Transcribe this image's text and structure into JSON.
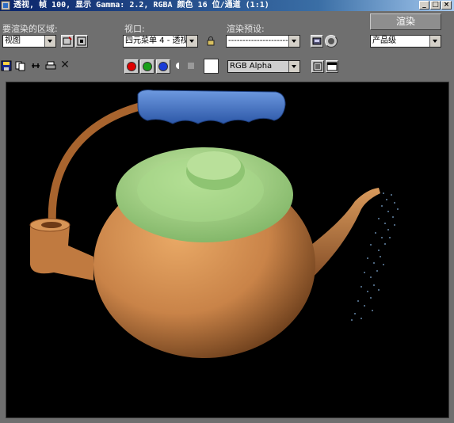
{
  "window": {
    "title": "透视, 帧 100, 显示 Gamma: 2.2, RGBA 颜色 16 位/通道 (1:1)",
    "min_label": "_",
    "max_label": "□",
    "close_label": "×"
  },
  "controls": {
    "area_label": "要渲染的区域:",
    "area_value": "视图",
    "viewport_label": "视口:",
    "viewport_value": "四元菜单 4 - 透视",
    "preset_label": "渲染预设:",
    "preset_value": "-------------------------",
    "render_button": "渲染",
    "quality_value": "产品级"
  },
  "toolbar": {
    "channel_value": "RGB Alpha",
    "channels": {
      "red": "#e00000",
      "green": "#1aa01a",
      "blue": "#1a3cd8"
    },
    "close_glyph": "✕"
  },
  "icons": {
    "save": "save-icon",
    "copy": "copy-icon",
    "clone": "clone-icon",
    "print": "print-icon",
    "clear": "close-icon",
    "lock": "lock-icon",
    "mono": "monochrome-icon"
  }
}
